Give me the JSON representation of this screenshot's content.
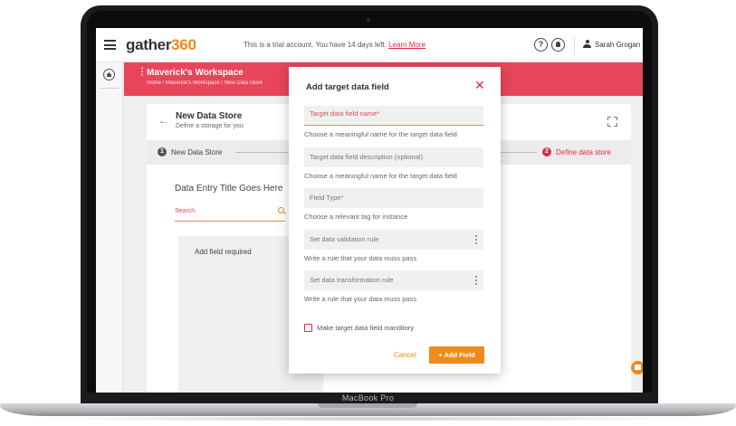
{
  "device": {
    "label": "MacBook Pro"
  },
  "topbar": {
    "logo_prefix": "gather",
    "logo_suffix": "360",
    "trial_text": "This is a trial account. You have 14 days left.",
    "learn_more": "Learn More",
    "help_glyph": "?",
    "user_name": "Sarah Grogan",
    "icons": [
      "menu-icon",
      "help-icon",
      "notification-icon",
      "user-icon"
    ]
  },
  "workspace": {
    "title": "Maverick's Workspace",
    "breadcrumb": "Home / Maverick's Workspace / New Data Store",
    "accent": "#e8455a"
  },
  "store": {
    "title": "New Data Store",
    "subtitle": "Define a storage for you"
  },
  "stepper": {
    "steps": [
      {
        "num": "1",
        "label": "New Data Store"
      },
      {
        "num": "2",
        "label": "Define data store"
      }
    ]
  },
  "entry": {
    "title": "Data Entry Title Goes Here",
    "search_label": "Search",
    "add_field_label": "Add field required"
  },
  "modal": {
    "title": "Add target data field",
    "fields": [
      {
        "label": "Target data field name*",
        "help": "Choose a meaningful name for the target data field"
      },
      {
        "label": "Target data field description (optional)",
        "help": "Choose a meaningful name for the target data field"
      },
      {
        "label": "Field Type*",
        "help": "Choose a relevant tag for instance"
      },
      {
        "label": "Set data validation rule",
        "help": "Write a rule that your data muss pass"
      },
      {
        "label": "Set data transformation rule",
        "help": "Write a rule that your data muss pass"
      }
    ],
    "checkbox_label": "Make target data field manditory",
    "cancel_label": "Cancel",
    "add_label": "+ Add Field"
  },
  "colors": {
    "brand_red": "#e0283f",
    "brand_orange": "#f08a1c"
  }
}
